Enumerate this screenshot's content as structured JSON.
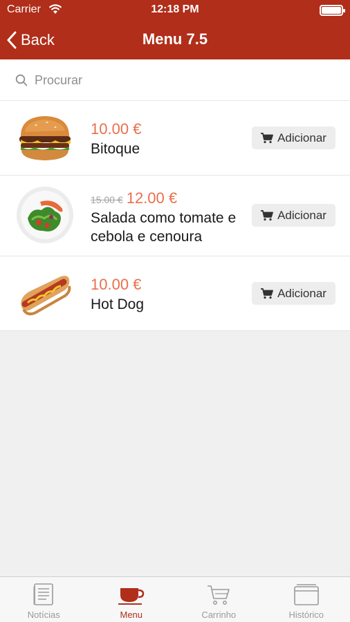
{
  "status_bar": {
    "carrier": "Carrier",
    "time": "12:18 PM"
  },
  "nav": {
    "back_label": "Back",
    "title": "Menu 7.5"
  },
  "search": {
    "placeholder": "Procurar"
  },
  "items": [
    {
      "price": "10.00 €",
      "old_price": "",
      "name": "Bitoque",
      "add_label": "Adicionar",
      "image": "burger"
    },
    {
      "price": "12.00 €",
      "old_price": "15.00 €",
      "name": "Salada como tomate e cebola e cenoura",
      "add_label": "Adicionar",
      "image": "salad"
    },
    {
      "price": "10.00 €",
      "old_price": "",
      "name": "Hot Dog",
      "add_label": "Adicionar",
      "image": "hotdog"
    }
  ],
  "tabs": [
    {
      "label": "Notícias",
      "icon": "newspaper-icon",
      "active": false
    },
    {
      "label": "Menu",
      "icon": "cup-icon",
      "active": true
    },
    {
      "label": "Carrinho",
      "icon": "cart-icon",
      "active": false
    },
    {
      "label": "Histórico",
      "icon": "archive-icon",
      "active": false
    }
  ],
  "colors": {
    "brand": "#b02e1a",
    "price": "#ea6f4c"
  }
}
